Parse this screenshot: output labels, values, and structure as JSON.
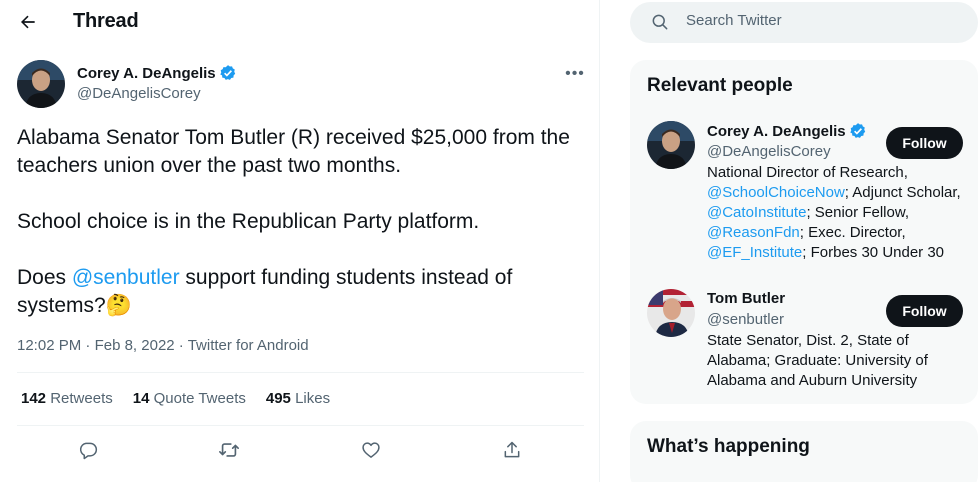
{
  "header": {
    "title": "Thread",
    "back_icon": "arrow-left-icon"
  },
  "tweet": {
    "author_name": "Corey A. DeAngelis",
    "author_handle": "@DeAngelisCorey",
    "verified": true,
    "more_icon": "ellipsis-icon",
    "text": {
      "line1": "Alabama Senator Tom Butler (R) received $25,000 from the teachers union over the past two months.",
      "line2": "School choice is in the Republican Party platform.",
      "line3_pre": "Does ",
      "line3_mention": "@senbutler",
      "line3_post": " support funding students instead of systems?",
      "emoji": "🤔"
    },
    "time": "12:02 PM",
    "date": "Feb 8, 2022",
    "source": "Twitter for Android",
    "separator": "·",
    "stats": [
      {
        "count": "142",
        "label": "Retweets"
      },
      {
        "count": "14",
        "label": "Quote Tweets"
      },
      {
        "count": "495",
        "label": "Likes"
      }
    ],
    "actions": [
      "reply-icon",
      "retweet-icon",
      "like-icon",
      "share-icon"
    ]
  },
  "search": {
    "placeholder": "Search Twitter",
    "value": "",
    "icon": "search-icon"
  },
  "relevant_people": {
    "title": "Relevant people",
    "people": [
      {
        "name": "Corey A. DeAngelis",
        "handle": "@DeAngelisCorey",
        "verified": true,
        "follow_label": "Follow",
        "bio": {
          "t1": "National Director of Research, ",
          "m1": "@SchoolChoiceNow",
          "t2": "; Adjunct Scholar, ",
          "m2": "@CatoInstitute",
          "t3": "; Senior Fellow, ",
          "m3": "@ReasonFdn",
          "t4": "; Exec. Director, ",
          "m4": "@EF_Institute",
          "t5": "; Forbes 30 Under 30"
        }
      },
      {
        "name": "Tom Butler",
        "handle": "@senbutler",
        "verified": false,
        "follow_label": "Follow",
        "bio_text": "State Senator, Dist. 2, State of Alabama; Graduate: University of Alabama and Auburn University"
      }
    ]
  },
  "whats_happening": {
    "title": "What’s happening"
  },
  "colors": {
    "accent": "#1d9bf0",
    "text": "#0f1419",
    "secondary": "#536471",
    "panel": "#f7f9f9",
    "button": "#0f1419"
  }
}
